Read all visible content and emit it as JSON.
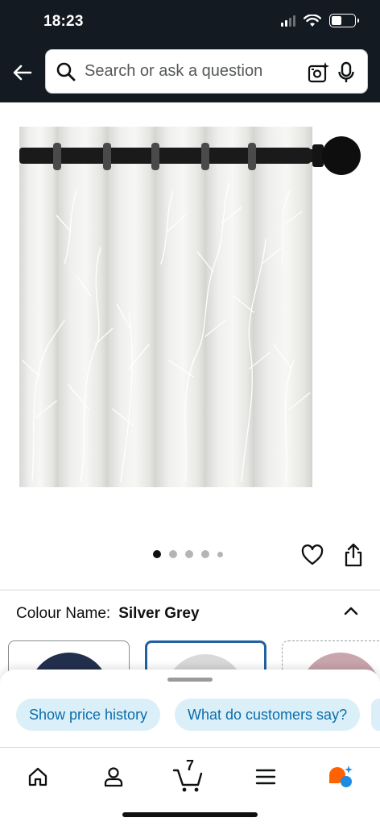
{
  "status_bar": {
    "time": "18:23",
    "battery_percent": 35
  },
  "header": {
    "search": {
      "placeholder": "Search or ask a question"
    },
    "icons": [
      "back-arrow-icon",
      "search-icon",
      "camera-sparkle-icon",
      "microphone-icon"
    ]
  },
  "product": {
    "image_description_icon": "curtain-image",
    "carousel": {
      "total": 5,
      "active_index": 0
    }
  },
  "variation": {
    "label": "Colour Name:",
    "value": "Silver Grey",
    "swatches": [
      {
        "color": "#23304d",
        "selected": false,
        "available": true
      },
      {
        "color": "#d9d9d9",
        "selected": true,
        "available": true
      },
      {
        "color": "#c9a5ad",
        "selected": false,
        "available": false
      }
    ]
  },
  "suggestions": {
    "chips": [
      "Show price history",
      "What do customers say?",
      ""
    ]
  },
  "bottom_nav": {
    "items": [
      "home-icon",
      "account-icon",
      "cart-icon",
      "menu-icon",
      "rufus-icon"
    ],
    "cart_count": "7"
  },
  "colors": {
    "header_bg": "#131a22",
    "chip_bg": "#dbeff8",
    "chip_text": "#0a6dad",
    "selected_border": "#2162a1",
    "rufus_orange": "#ff6200",
    "rufus_blue": "#1d8ce0"
  }
}
